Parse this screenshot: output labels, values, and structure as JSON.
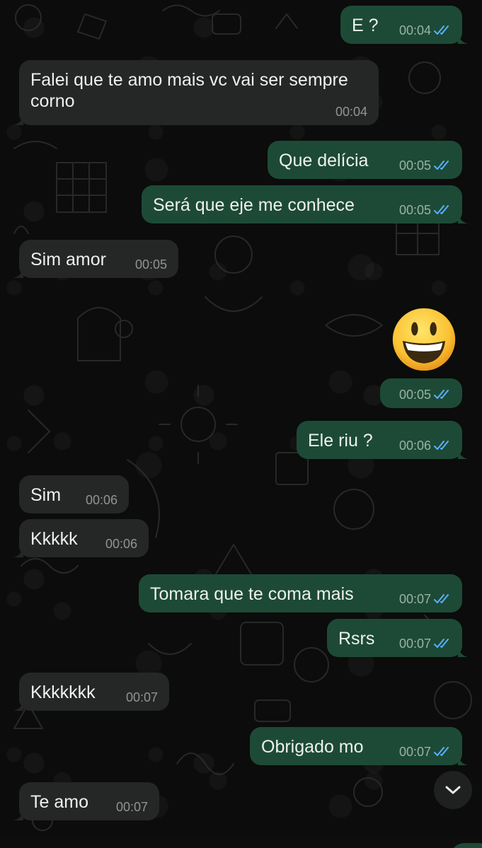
{
  "colors": {
    "incoming_bubble": "#252626",
    "outgoing_bubble": "#1d4a36",
    "background": "#0b0c0b",
    "read_ticks": "#5ab0ff"
  },
  "messages": [
    {
      "direction": "out",
      "text": "E ?",
      "time": "00:04",
      "status": "read"
    },
    {
      "direction": "in",
      "text": "Falei que te amo mais vc vai ser sempre corno",
      "time": "00:04"
    },
    {
      "direction": "out",
      "text": "Que delícia",
      "time": "00:05",
      "status": "read"
    },
    {
      "direction": "out",
      "text": "Será que eje me conhece",
      "time": "00:05",
      "status": "read"
    },
    {
      "direction": "in",
      "text": "Sim amor",
      "time": "00:05"
    },
    {
      "direction": "out",
      "emoji": "grinning-face-emoji",
      "time": "00:05",
      "status": "read"
    },
    {
      "direction": "out",
      "text": "Ele riu ?",
      "time": "00:06",
      "status": "read"
    },
    {
      "direction": "in",
      "text": "Sim",
      "time": "00:06"
    },
    {
      "direction": "in",
      "text": "Kkkkk",
      "time": "00:06"
    },
    {
      "direction": "out",
      "text": "Tomara que te coma mais",
      "time": "00:07",
      "status": "read"
    },
    {
      "direction": "out",
      "text": "Rsrs",
      "time": "00:07",
      "status": "read"
    },
    {
      "direction": "in",
      "text": "Kkkkkkk",
      "time": "00:07"
    },
    {
      "direction": "out",
      "text": "Obrigado mo",
      "time": "00:07",
      "status": "read"
    },
    {
      "direction": "in",
      "text": "Te amo",
      "time": "00:07"
    }
  ],
  "scroll_button": {
    "icon": "chevron-down-icon"
  }
}
